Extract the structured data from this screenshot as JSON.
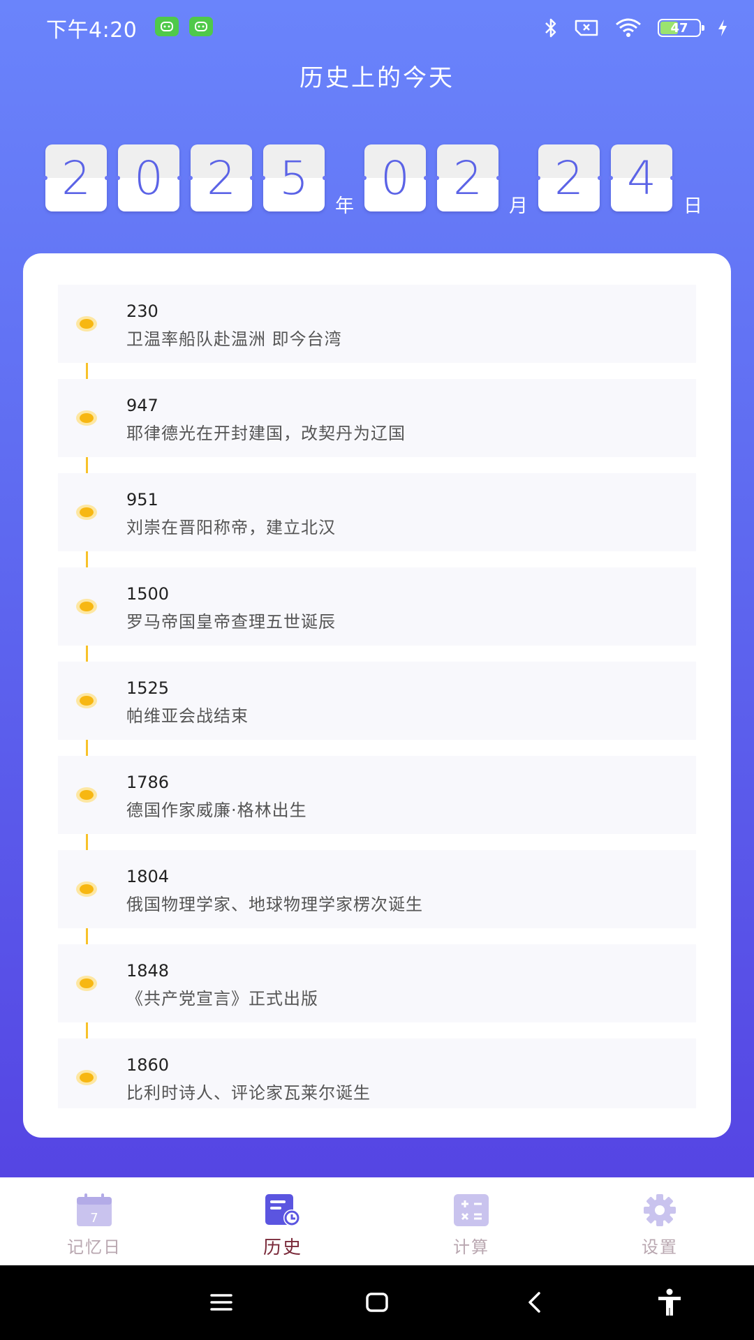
{
  "status_bar": {
    "time": "下午4:20",
    "battery_level": 47,
    "battery_text": "47"
  },
  "title": "历史上的今天",
  "date": {
    "year_digits": [
      "2",
      "0",
      "2",
      "5"
    ],
    "year_unit": "年",
    "month_digits": [
      "0",
      "2"
    ],
    "month_unit": "月",
    "day_digits": [
      "2",
      "4"
    ],
    "day_unit": "日"
  },
  "events": [
    {
      "year": "230",
      "desc": "卫温率船队赴温洲 即今台湾"
    },
    {
      "year": "947",
      "desc": "耶律德光在开封建国，改契丹为辽国"
    },
    {
      "year": "951",
      "desc": "刘崇在晋阳称帝，建立北汉"
    },
    {
      "year": "1500",
      "desc": "罗马帝国皇帝查理五世诞辰"
    },
    {
      "year": "1525",
      "desc": "帕维亚会战结束"
    },
    {
      "year": "1786",
      "desc": "德国作家威廉·格林出生"
    },
    {
      "year": "1804",
      "desc": "俄国物理学家、地球物理学家楞次诞生"
    },
    {
      "year": "1848",
      "desc": "《共产党宣言》正式出版"
    },
    {
      "year": "1860",
      "desc": "比利时诗人、评论家瓦莱尔诞生"
    }
  ],
  "nav": {
    "items": [
      {
        "label": "记忆日",
        "icon": "calendar-icon",
        "active": false
      },
      {
        "label": "历史",
        "icon": "history-icon",
        "active": true
      },
      {
        "label": "计算",
        "icon": "calculator-icon",
        "active": false
      },
      {
        "label": "设置",
        "icon": "gear-icon",
        "active": false
      }
    ]
  },
  "colors": {
    "accent": "#5b63e6",
    "timeline": "#f8c22a",
    "nav_active": "#7a2a3a",
    "nav_inactive": "#b9a7b0"
  }
}
